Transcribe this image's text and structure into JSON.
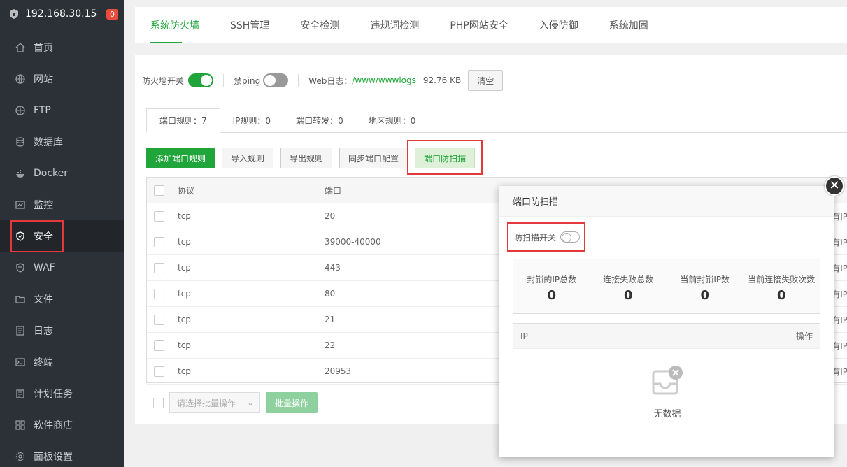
{
  "sidebar": {
    "ip": "192.168.30.15",
    "badge": "0",
    "items": [
      {
        "label": "首页",
        "icon": "home-icon"
      },
      {
        "label": "网站",
        "icon": "globe-icon"
      },
      {
        "label": "FTP",
        "icon": "ftp-icon"
      },
      {
        "label": "数据库",
        "icon": "database-icon"
      },
      {
        "label": "Docker",
        "icon": "docker-icon"
      },
      {
        "label": "监控",
        "icon": "monitor-icon"
      },
      {
        "label": "安全",
        "icon": "shield-icon"
      },
      {
        "label": "WAF",
        "icon": "waf-icon"
      },
      {
        "label": "文件",
        "icon": "folder-icon"
      },
      {
        "label": "日志",
        "icon": "log-icon"
      },
      {
        "label": "终端",
        "icon": "terminal-icon"
      },
      {
        "label": "计划任务",
        "icon": "calendar-icon"
      },
      {
        "label": "软件商店",
        "icon": "grid-icon"
      },
      {
        "label": "面板设置",
        "icon": "gear-icon"
      }
    ],
    "active_index": 6
  },
  "tabs": [
    "系统防火墙",
    "SSH管理",
    "安全检测",
    "违规词检测",
    "PHP网站安全",
    "入侵防御",
    "系统加固"
  ],
  "toolbar": {
    "firewall_label": "防火墙开关",
    "ping_label": "禁ping",
    "weblog_label": "Web日志：",
    "weblog_path": "/www/wwwlogs",
    "weblog_size": "92.76 KB",
    "clear_label": "清空"
  },
  "subtabs": [
    "端口规则：7",
    "IP规则：0",
    "端口转发：0",
    "地区规则：0"
  ],
  "actions": {
    "add": "添加端口规则",
    "import": "导入规则",
    "export": "导出规则",
    "sync": "同步端口配置",
    "scan": "端口防扫描"
  },
  "table": {
    "headers": {
      "protocol": "协议",
      "port": "端口"
    },
    "rows": [
      {
        "protocol": "tcp",
        "port": "20",
        "tail": "有IP"
      },
      {
        "protocol": "tcp",
        "port": "39000-40000",
        "tail": "有IP"
      },
      {
        "protocol": "tcp",
        "port": "443",
        "tail": "有IP"
      },
      {
        "protocol": "tcp",
        "port": "80",
        "tail": "有IP"
      },
      {
        "protocol": "tcp",
        "port": "21",
        "tail": "有IP"
      },
      {
        "protocol": "tcp",
        "port": "22",
        "tail": "有IP"
      },
      {
        "protocol": "tcp",
        "port": "20953",
        "tail": "有IP"
      }
    ]
  },
  "batch": {
    "placeholder": "请选择批量操作",
    "button": "批量操作"
  },
  "modal": {
    "title": "端口防扫描",
    "switch_label": "防扫描开关",
    "stats": [
      {
        "label": "封锁的IP总数",
        "value": "0"
      },
      {
        "label": "连接失败总数",
        "value": "0"
      },
      {
        "label": "当前封锁IP数",
        "value": "0"
      },
      {
        "label": "当前连接失败次数",
        "value": "0"
      }
    ],
    "ip_header": "IP",
    "op_header": "操作",
    "empty_text": "无数据"
  },
  "colors": {
    "accent": "#20a53a",
    "highlight": "#e4393c",
    "sidebar": "#2c3138"
  }
}
